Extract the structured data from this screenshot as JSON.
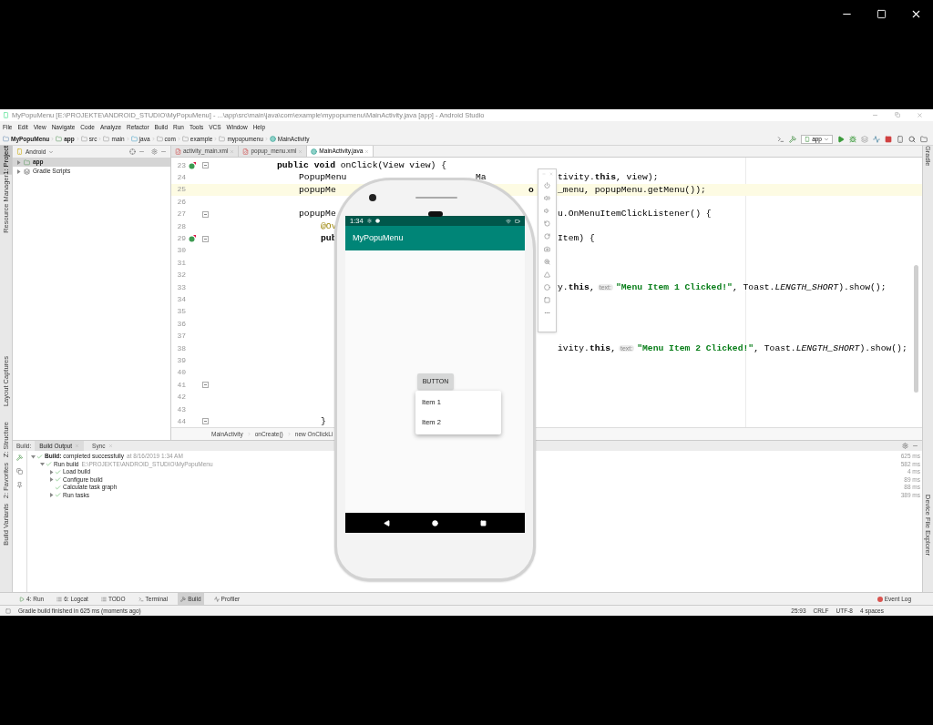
{
  "window": {
    "title": "MyPopuMenu [E:\\PROJEKTE\\ANDROID_STUDIO\\MyPopuMenu] - ...\\app\\src\\main\\java\\com\\example\\mypopumenu\\MainActivity.java [app] - Android Studio"
  },
  "menu": [
    "File",
    "Edit",
    "View",
    "Navigate",
    "Code",
    "Analyze",
    "Refactor",
    "Build",
    "Run",
    "Tools",
    "VCS",
    "Window",
    "Help"
  ],
  "breadcrumbs": [
    {
      "label": "MyPopuMenu",
      "kind": "project"
    },
    {
      "label": "app",
      "kind": "module"
    },
    {
      "label": "src",
      "kind": "folder"
    },
    {
      "label": "main",
      "kind": "folder"
    },
    {
      "label": "java",
      "kind": "source"
    },
    {
      "label": "com",
      "kind": "folder"
    },
    {
      "label": "example",
      "kind": "folder"
    },
    {
      "label": "mypopumenu",
      "kind": "folder"
    },
    {
      "label": "MainActivity",
      "kind": "class"
    }
  ],
  "run_config": "app",
  "left_tool_tabs": [
    {
      "label": "1: Project",
      "selected": true
    },
    {
      "label": "Resource Manager",
      "selected": false
    }
  ],
  "left_tool_tabs_lower": [
    {
      "label": "Layout Captures",
      "selected": false
    },
    {
      "label": "Z: Structure",
      "selected": false
    },
    {
      "label": "2: Favorites",
      "selected": false
    },
    {
      "label": "Build Variants",
      "selected": false
    }
  ],
  "right_tool_tabs": [
    {
      "label": "Gradle",
      "selected": false
    },
    {
      "label": "Device File Explorer",
      "selected": false
    }
  ],
  "project": {
    "view": "Android",
    "tree": [
      {
        "label": "app",
        "kind": "module",
        "selected": true,
        "expanded": false
      },
      {
        "label": "Gradle Scripts",
        "kind": "gradle",
        "selected": false,
        "expanded": false
      }
    ]
  },
  "editor_tabs": [
    {
      "label": "activity_main.xml",
      "kind": "xml",
      "selected": false
    },
    {
      "label": "popup_menu.xml",
      "kind": "xml",
      "selected": false
    },
    {
      "label": "MainActivity.java",
      "kind": "class",
      "selected": true
    }
  ],
  "code_lines": [
    {
      "n": "23",
      "kind": "method",
      "current": false,
      "override_marker": true,
      "fold": true,
      "left": [
        {
          "text": "**public void** onClick(View view) {",
          "kind": "code"
        }
      ]
    },
    {
      "n": "24",
      "kind": "statement",
      "current": false,
      "override_marker": false,
      "fold": false,
      "left": [
        {
          "text": "PopupMenu",
          "kind": "code"
        }
      ],
      "mid": "Ma",
      "right": [
        {
          "text": "tivity.**this**, view);",
          "kind": "code"
        }
      ]
    },
    {
      "n": "25",
      "kind": "statement",
      "current": true,
      "override_marker": false,
      "fold": false,
      "left": [
        {
          "text": "popupMe",
          "kind": "code"
        }
      ],
      "edge": "o",
      "right": [
        {
          "text": "_menu, popupMenu.getMenu());",
          "kind": "code"
        }
      ]
    },
    {
      "n": "26",
      "kind": "blank",
      "current": false,
      "override_marker": false,
      "fold": false
    },
    {
      "n": "27",
      "kind": "statement",
      "current": false,
      "override_marker": false,
      "fold": true,
      "left": [
        {
          "text": "popupMe",
          "kind": "code"
        }
      ],
      "right": [
        {
          "text": "u.OnMenuItemClickListener() {",
          "kind": "code"
        }
      ]
    },
    {
      "n": "28",
      "kind": "body",
      "current": false,
      "override_marker": false,
      "fold": false,
      "left": [
        {
          "text": "@Ov",
          "kind": "annotation"
        }
      ]
    },
    {
      "n": "29",
      "kind": "body",
      "current": false,
      "override_marker": true,
      "fold": true,
      "left": [
        {
          "text": "**pub**",
          "kind": "code"
        }
      ],
      "right": [
        {
          "text": "Item) {",
          "kind": "code"
        }
      ]
    },
    {
      "n": "30",
      "kind": "blank",
      "current": false,
      "override_marker": false,
      "fold": false
    },
    {
      "n": "31",
      "kind": "blank",
      "current": false,
      "override_marker": false,
      "fold": false
    },
    {
      "n": "32",
      "kind": "blank",
      "current": false,
      "override_marker": false,
      "fold": false
    },
    {
      "n": "33",
      "kind": "blank",
      "current": false,
      "override_marker": false,
      "fold": false,
      "right": [
        {
          "text": "y.**this**,",
          "kind": "code"
        },
        {
          "text": "text:",
          "kind": "hint"
        },
        {
          "text": "\"Menu Item 1 Clicked!\"",
          "kind": "string"
        },
        {
          "text": ", Toast.*LENGTH_SHORT*).show();",
          "kind": "code"
        }
      ]
    },
    {
      "n": "34",
      "kind": "blank",
      "current": false,
      "override_marker": false,
      "fold": false
    },
    {
      "n": "35",
      "kind": "blank",
      "current": false,
      "override_marker": false,
      "fold": false
    },
    {
      "n": "36",
      "kind": "blank",
      "current": false,
      "override_marker": false,
      "fold": false
    },
    {
      "n": "37",
      "kind": "blank",
      "current": false,
      "override_marker": false,
      "fold": false
    },
    {
      "n": "38",
      "kind": "blank",
      "current": false,
      "override_marker": false,
      "fold": false,
      "right": [
        {
          "text": "ivity.**this**,",
          "kind": "code"
        },
        {
          "text": "text:",
          "kind": "hint"
        },
        {
          "text": "\"Menu Item 2 Clicked!\"",
          "kind": "string"
        },
        {
          "text": ", Toast.*LENGTH_SHORT*).show();",
          "kind": "code"
        }
      ]
    },
    {
      "n": "39",
      "kind": "blank",
      "current": false,
      "override_marker": false,
      "fold": false
    },
    {
      "n": "40",
      "kind": "blank",
      "current": false,
      "override_marker": false,
      "fold": false
    },
    {
      "n": "41",
      "kind": "blank",
      "current": false,
      "override_marker": false,
      "fold": true
    },
    {
      "n": "42",
      "kind": "blank",
      "current": false,
      "override_marker": false,
      "fold": false
    },
    {
      "n": "43",
      "kind": "blank",
      "current": false,
      "override_marker": false,
      "fold": false
    },
    {
      "n": "44",
      "kind": "body",
      "current": false,
      "override_marker": false,
      "fold": true,
      "left": [
        {
          "text": "}",
          "kind": "code"
        }
      ]
    }
  ],
  "editor_breadcrumbs": [
    "MainActivity",
    "onCreate()",
    "new OnClickLi"
  ],
  "emulator": {
    "time": "1:34",
    "app_title": "MyPopuMenu",
    "button": "BUTTON",
    "popup_items": [
      "Item 1",
      "Item 2"
    ]
  },
  "build": {
    "label": "Build:",
    "tabs": [
      {
        "label": "Build Output",
        "selected": true
      },
      {
        "label": "Sync",
        "selected": false
      }
    ],
    "tree": [
      {
        "label": "**Build:** completed successfully",
        "detail": "at 8/16/2019 1:34 AM",
        "time": "625 ms",
        "expandable": true,
        "expanded": true,
        "children": [
          {
            "label": "Run build",
            "detail": "E:\\PROJEKTE\\ANDROID_STUDIO\\MyPopuMenu",
            "time": "582 ms",
            "expandable": true,
            "expanded": true,
            "children": [
              {
                "label": "Load build",
                "time": "4 ms",
                "expandable": true
              },
              {
                "label": "Configure build",
                "time": "89 ms",
                "expandable": true
              },
              {
                "label": "Calculate task graph",
                "time": "88 ms",
                "expandable": false
              },
              {
                "label": "Run tasks",
                "time": "389 ms",
                "expandable": true
              }
            ]
          }
        ]
      }
    ]
  },
  "bottom_tabs": [
    {
      "label": "4: Run",
      "kind": "run",
      "selected": false
    },
    {
      "label": "6: Logcat",
      "kind": "logcat",
      "selected": false
    },
    {
      "label": "TODO",
      "kind": "todo",
      "selected": false
    },
    {
      "label": "Terminal",
      "kind": "terminal",
      "selected": false
    },
    {
      "label": "Build",
      "kind": "build",
      "selected": true
    },
    {
      "label": "Profiler",
      "kind": "profiler",
      "selected": false
    }
  ],
  "event_log": "Event Log",
  "status": {
    "message": "Gradle build finished in 625 ms (moments ago)",
    "position": "25:93",
    "line_separator": "CRLF",
    "encoding": "UTF-8",
    "indent": "4 spaces"
  }
}
